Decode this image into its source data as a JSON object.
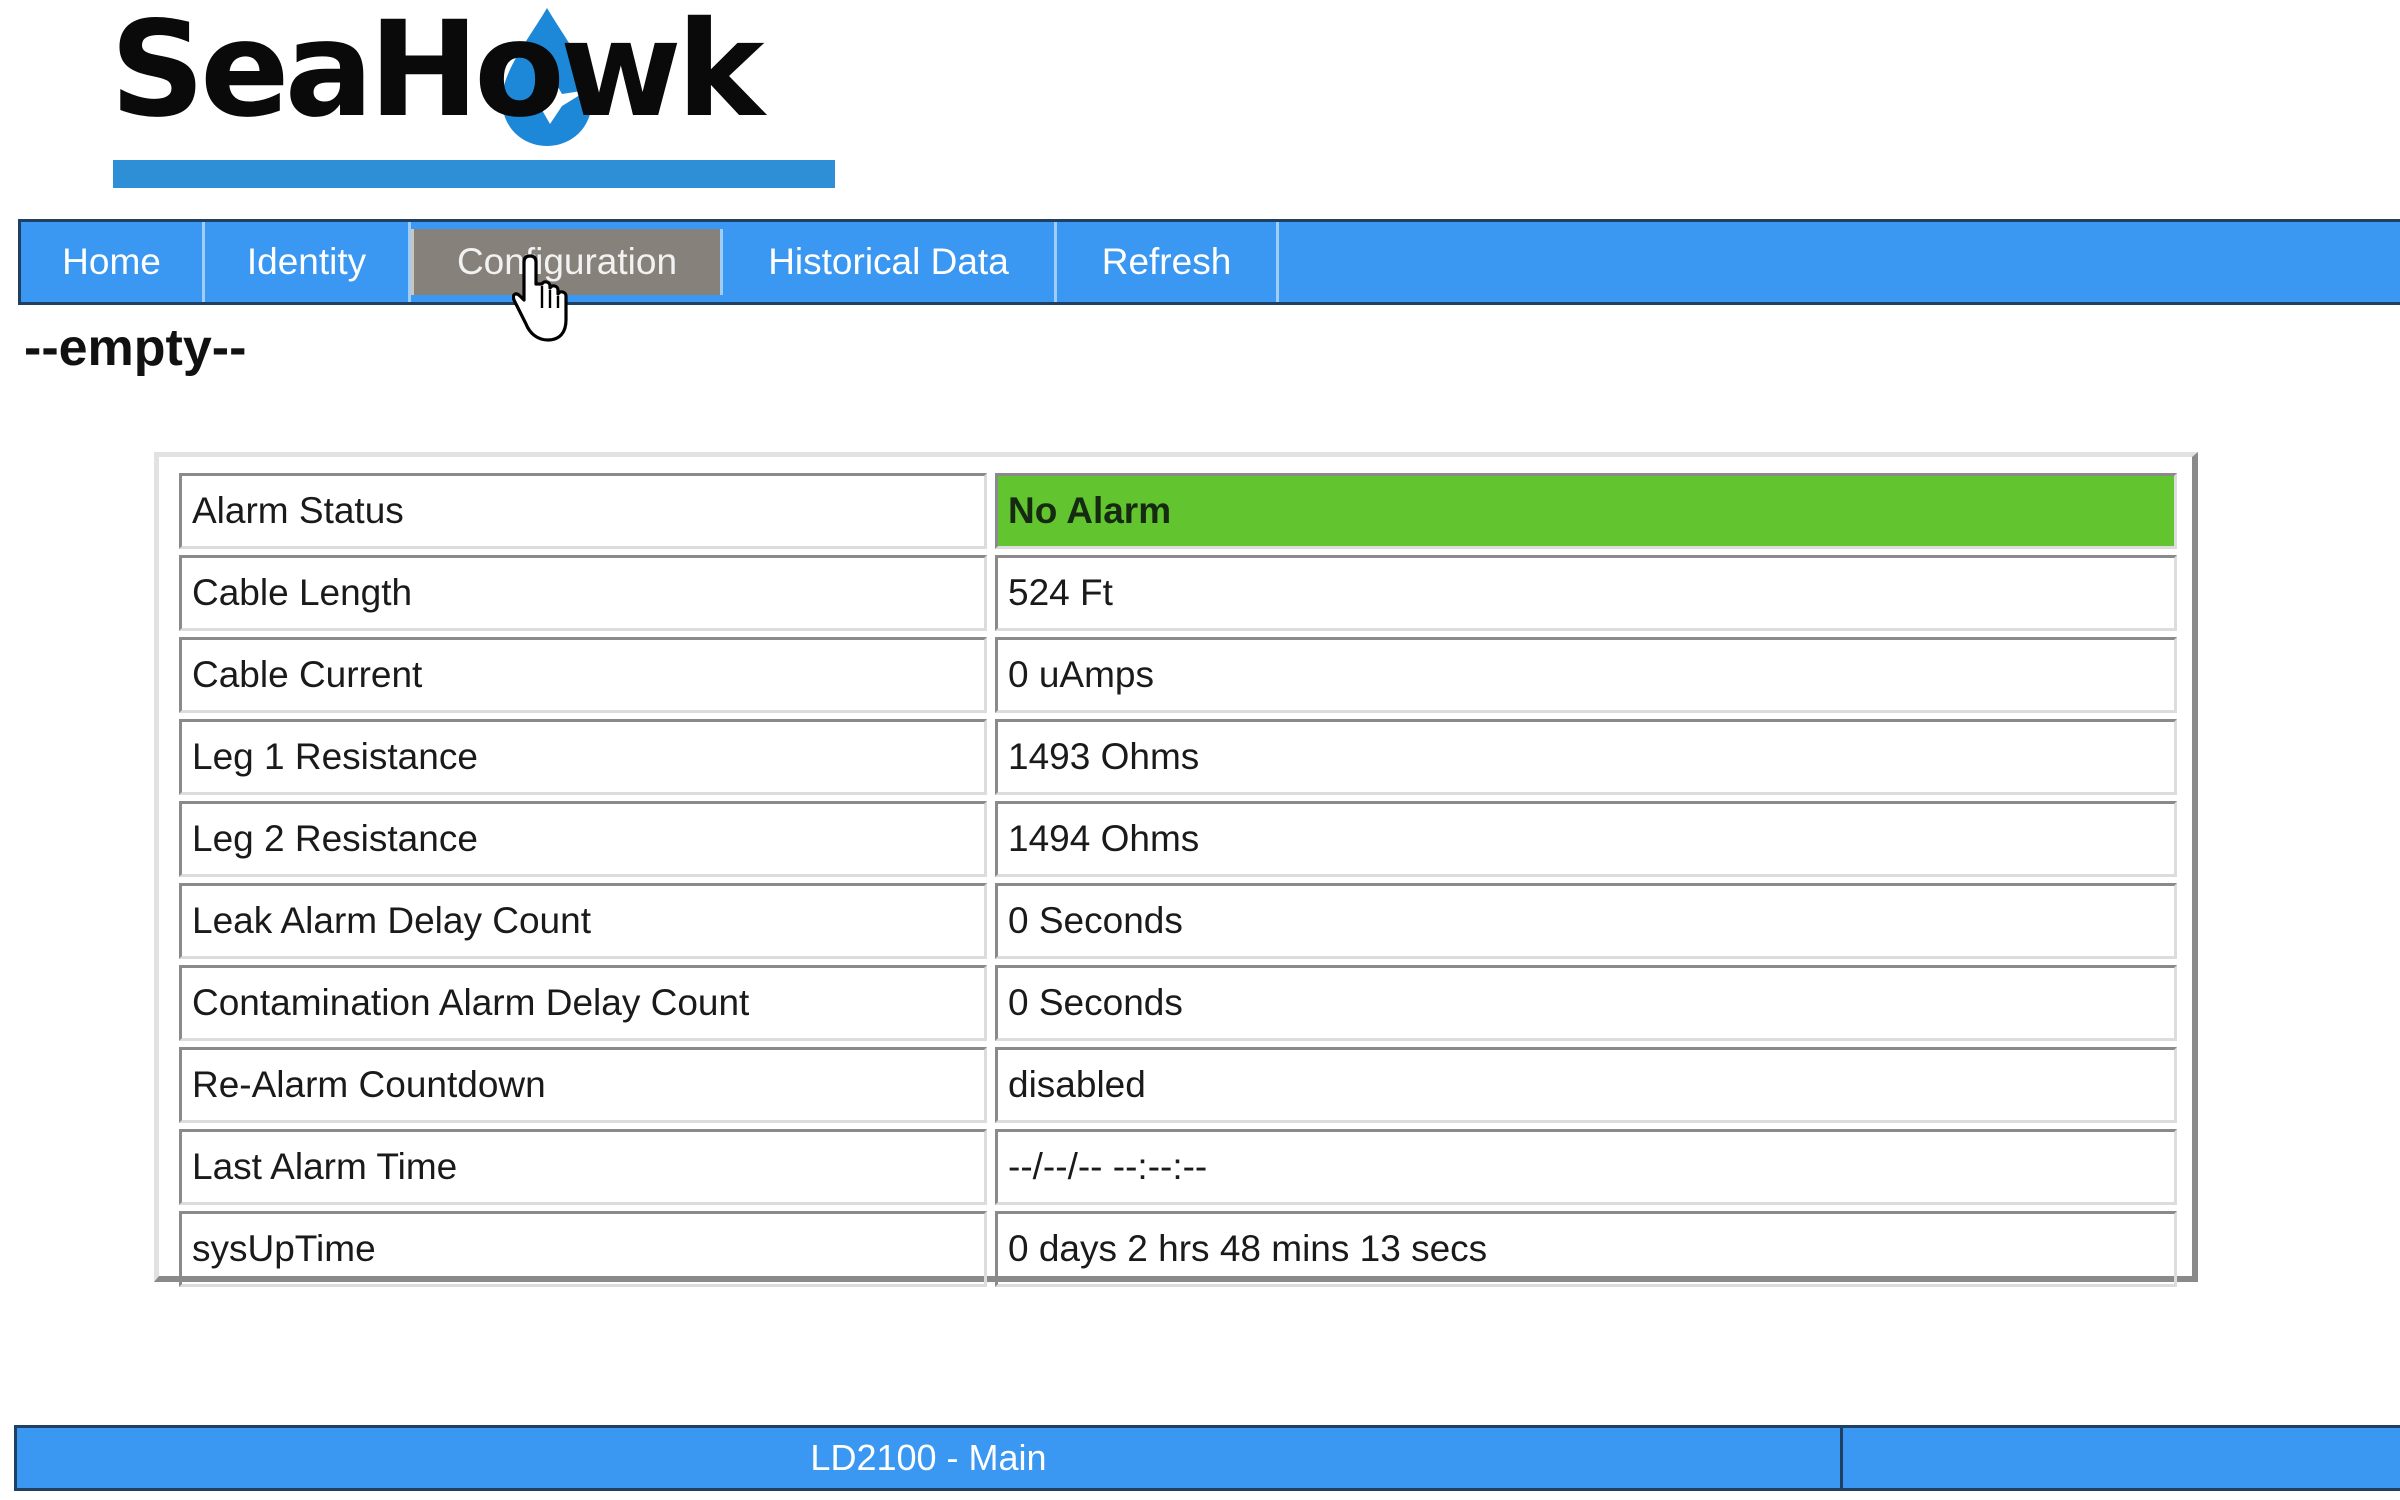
{
  "brand": {
    "logo_text": "SeaHowk",
    "accent_color": "#2f8fd6",
    "drop_color": "#1e88d8",
    "nav_color": "#3a97f2",
    "active_tab_color": "#86817a",
    "status_ok_color": "#62c42e"
  },
  "nav": {
    "items": [
      {
        "label": "Home",
        "active": false
      },
      {
        "label": "Identity",
        "active": false
      },
      {
        "label": "Configuration",
        "active": true
      },
      {
        "label": "Historical Data",
        "active": false
      },
      {
        "label": "Refresh",
        "active": false
      }
    ]
  },
  "cursor": {
    "icon": "hand-pointer-icon"
  },
  "page": {
    "heading": "--empty--"
  },
  "status_table": {
    "rows": [
      {
        "label": "Alarm Status",
        "value": "No Alarm",
        "state": "ok"
      },
      {
        "label": "Cable Length",
        "value": "524 Ft"
      },
      {
        "label": "Cable Current",
        "value": "0 uAmps"
      },
      {
        "label": "Leg 1 Resistance",
        "value": "1493 Ohms"
      },
      {
        "label": "Leg 2 Resistance",
        "value": "1494 Ohms"
      },
      {
        "label": "Leak Alarm Delay Count",
        "value": "0 Seconds"
      },
      {
        "label": "Contamination Alarm Delay Count",
        "value": "0 Seconds"
      },
      {
        "label": "Re-Alarm Countdown",
        "value": "disabled"
      },
      {
        "label": "Last Alarm Time",
        "value": "--/--/-- --:--:--"
      },
      {
        "label": "sysUpTime",
        "value": "0 days 2 hrs 48 mins 13 secs"
      }
    ]
  },
  "footer": {
    "title": "LD2100 - Main"
  }
}
